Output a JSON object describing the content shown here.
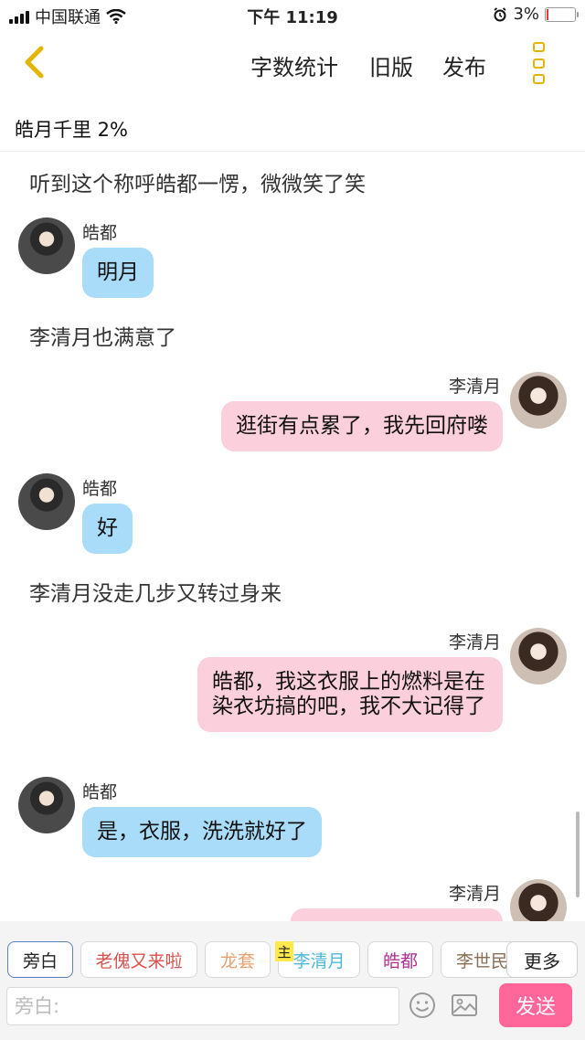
{
  "status_bar": {
    "carrier": "中国联通",
    "time": "下午 11:19",
    "battery_percent": "3%",
    "battery_level": 0.03
  },
  "nav": {
    "word_count": "字数统计",
    "old_version": "旧版",
    "publish": "发布"
  },
  "progress_text": "皓月千里 2%",
  "chat": {
    "narrations": [
      "听到这个称呼皓都一愣，微微笑了笑",
      "李清月也满意了",
      "李清月没走几步又转过身来"
    ],
    "messages": [
      {
        "name": "皓都",
        "text": "明月"
      },
      {
        "name": "李清月",
        "text": "逛街有点累了，我先回府喽"
      },
      {
        "name": "皓都",
        "text": "好"
      },
      {
        "name": "李清月",
        "text": "皓都，我这衣服上的燃料是在染衣坊搞的吧，我不大记得了"
      },
      {
        "name": "皓都",
        "text": "是，衣服，洗洗就好了"
      },
      {
        "name": "李清月",
        "text": ""
      }
    ]
  },
  "roles": {
    "items": [
      {
        "label": "旁白",
        "color": "#222222"
      },
      {
        "label": "老傀又来啦",
        "color": "#d9534f"
      },
      {
        "label": "龙套",
        "color": "#e8a070"
      },
      {
        "label": "李清月",
        "color": "#4db8d8"
      },
      {
        "label": "皓都",
        "color": "#b03090"
      },
      {
        "label": "李世民",
        "color": "#8a6f55"
      }
    ],
    "host_tag": "主",
    "more": "更多"
  },
  "composer": {
    "placeholder": "旁白:",
    "send": "发送"
  },
  "colors": {
    "accent": "#e3b400",
    "male_bubble": "#a8dcf8",
    "female_bubble": "#fbcfdb",
    "send": "#ff6699"
  }
}
